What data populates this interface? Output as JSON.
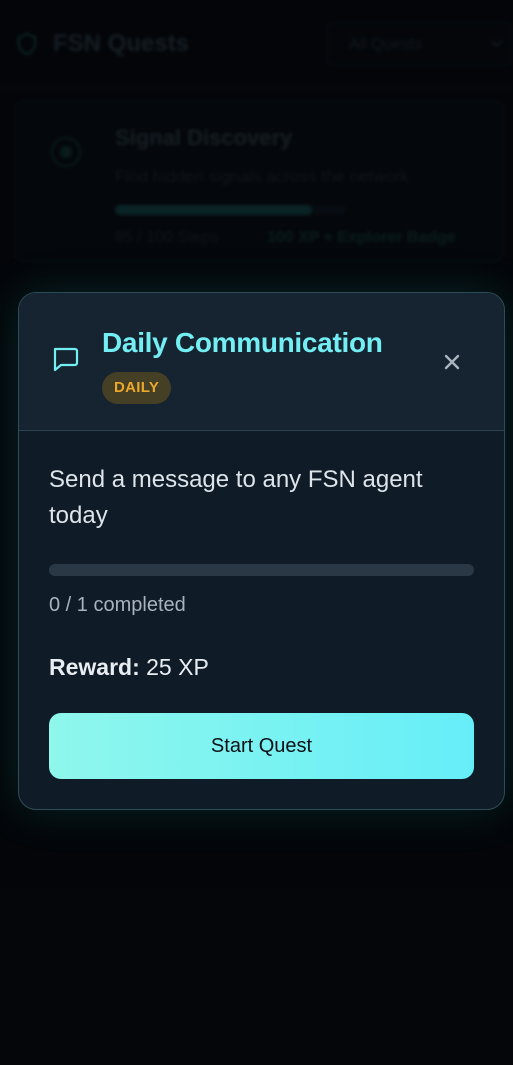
{
  "app": {
    "title": "FSN Quests",
    "filter_value": "All Quests"
  },
  "background_quest": {
    "title": "Signal Discovery",
    "description": "Find hidden signals across the network",
    "progress_fraction": 0.85,
    "steps_text": "85 / 100 Steps",
    "reward_text": "100 XP + Explorer Badge"
  },
  "modal": {
    "title": "Daily Communication",
    "badge": "DAILY",
    "description": "Send a message to any FSN agent today",
    "progress_fraction": 0,
    "progress_text": "0 / 1 completed",
    "reward_label": "Reward:",
    "reward_value": "25 XP",
    "start_button_label": "Start Quest",
    "icon": "message-square-icon",
    "close_icon": "close-icon"
  },
  "colors": {
    "accent_cyan": "#73eef3",
    "badge_bg": "#453f25",
    "badge_text": "#eba829",
    "button_gradient_start": "#8ff7ec",
    "button_gradient_end": "#66eef8",
    "modal_bg": "#0f1b27"
  }
}
